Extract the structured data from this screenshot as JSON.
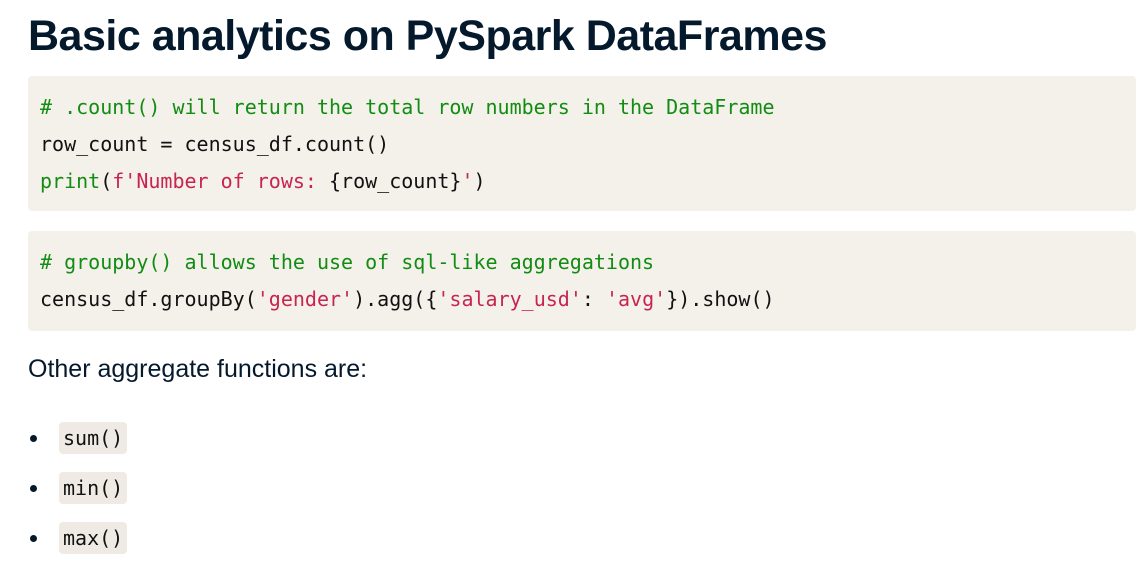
{
  "title": "Basic analytics on PySpark DataFrames",
  "code_block_1": {
    "line1": {
      "comment": "# .count() will return the total row numbers in the DataFrame"
    },
    "line2": {
      "text": "row_count = census_df.count()"
    },
    "line3": {
      "fn": "print",
      "open": "(",
      "fstring_prefix": "f'Number of rows: ",
      "expr": "{row_count}",
      "fstring_end": "'",
      "close": ")"
    }
  },
  "code_block_2": {
    "line1": {
      "comment": "# groupby() allows the use of sql-like aggregations"
    },
    "line2": {
      "part1": "census_df.groupBy(",
      "str1": "'gender'",
      "part2": ").agg({",
      "str2": "'salary_usd'",
      "part3": ": ",
      "str3": "'avg'",
      "part4": "}).show()"
    }
  },
  "paragraph": "Other aggregate functions are:",
  "functions": [
    "sum()",
    "min()",
    "max()"
  ],
  "colors": {
    "heading": "#05192d",
    "code_background": "#f4f1ea",
    "comment": "#128c12",
    "string": "#c7254e"
  }
}
